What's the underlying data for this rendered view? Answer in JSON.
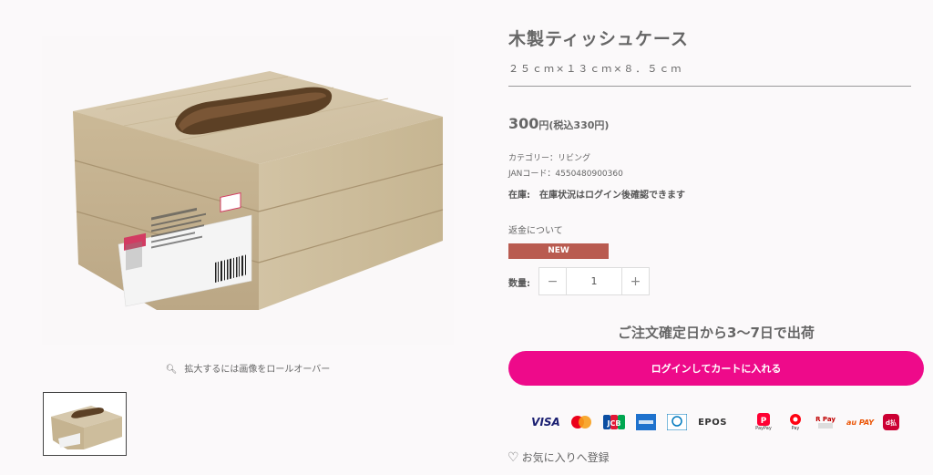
{
  "product": {
    "title": "木製ティッシュケース",
    "size": "２５ｃｍ×１３ｃｍ×８．５ｃｍ",
    "price_main": "300",
    "price_yen": "円",
    "price_tax": "(税込330円)",
    "category": "カテゴリー：リビング",
    "jan": "JANコード：4550480900360",
    "stock_label": "在庫:",
    "stock_value": "在庫状況はログイン後確認できます",
    "refund": "返金について",
    "badge": "NEW",
    "qty_label": "数量:",
    "qty_value": "1",
    "shipping": "ご注文確定日から3〜7日で出荷",
    "cart_button": "ログインしてカートに入れる",
    "favorite": "お気に入りへ登録"
  },
  "gallery": {
    "zoom_hint": "拡大するには画像をロールオーバー"
  },
  "payments": [
    {
      "name": "VISA",
      "icon": "visa-icon",
      "color": "#1a1f71"
    },
    {
      "name": "",
      "icon": "mastercard-icon",
      "color": "#eb001b"
    },
    {
      "name": "JCB",
      "icon": "jcb-icon",
      "color": "#0b6db6"
    },
    {
      "name": "",
      "icon": "amex-icon",
      "color": "#1f72cd"
    },
    {
      "name": "",
      "icon": "diners-icon",
      "color": "#0079be"
    },
    {
      "name": "EPOS",
      "icon": "epos-icon",
      "color": "#333333"
    },
    {
      "name": "PayPay",
      "icon": "paypay-icon",
      "color": "#ff0033"
    },
    {
      "name": "Pay",
      "icon": "merpay-icon",
      "color": "#ff0211"
    },
    {
      "name": "R Pay",
      "icon": "rakuten-pay-icon",
      "color": "#bf0000"
    },
    {
      "name": "au PAY",
      "icon": "au-pay-icon",
      "color": "#eb5505"
    },
    {
      "name": "d払い",
      "icon": "d-barai-icon",
      "color": "#cc0033"
    }
  ],
  "colors": {
    "accent": "#ee0a8a",
    "badge": "#b95b50"
  }
}
